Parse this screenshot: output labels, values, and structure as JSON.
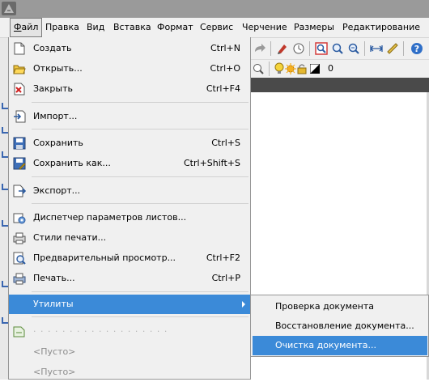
{
  "menubar": {
    "items": [
      {
        "label": "Файл"
      },
      {
        "label": "Правка"
      },
      {
        "label": "Вид"
      },
      {
        "label": "Вставка"
      },
      {
        "label": "Формат"
      },
      {
        "label": "Сервис"
      },
      {
        "label": "Черчение"
      },
      {
        "label": "Размеры"
      },
      {
        "label": "Редактирование"
      }
    ]
  },
  "file_menu": {
    "items": [
      {
        "label": "Создать",
        "shortcut": "Ctrl+N",
        "icon": "new-document-icon"
      },
      {
        "label": "Открыть...",
        "shortcut": "Ctrl+O",
        "icon": "open-folder-icon"
      },
      {
        "label": "Закрыть",
        "shortcut": "Ctrl+F4",
        "icon": "close-document-icon"
      },
      {
        "label": "Импорт...",
        "shortcut": "",
        "icon": "import-icon"
      },
      {
        "label": "Сохранить",
        "shortcut": "Ctrl+S",
        "icon": "save-icon"
      },
      {
        "label": "Сохранить как...",
        "shortcut": "Ctrl+Shift+S",
        "icon": "save-as-icon"
      },
      {
        "label": "Экспорт...",
        "shortcut": "",
        "icon": "export-icon"
      },
      {
        "label": "Диспетчер параметров листов...",
        "shortcut": "",
        "icon": "page-setup-icon"
      },
      {
        "label": "Стили печати...",
        "shortcut": "",
        "icon": "print-styles-icon"
      },
      {
        "label": "Предварительный просмотр...",
        "shortcut": "Ctrl+F2",
        "icon": "print-preview-icon"
      },
      {
        "label": "Печать...",
        "shortcut": "Ctrl+P",
        "icon": "print-icon"
      },
      {
        "label": "Утилиты",
        "shortcut": "",
        "icon": ""
      },
      {
        "label": "<Пусто>",
        "shortcut": "",
        "icon": ""
      },
      {
        "label": "<Пусто>",
        "shortcut": "",
        "icon": ""
      }
    ]
  },
  "utilities_submenu": {
    "items": [
      {
        "label": "Проверка документа"
      },
      {
        "label": "Восстановление документа..."
      },
      {
        "label": "Очистка документа..."
      }
    ]
  },
  "layer_toolbar": {
    "current_layer": "0"
  },
  "colors": {
    "highlight": "#3b8ad8",
    "menu_bg": "#f0f0f0"
  }
}
